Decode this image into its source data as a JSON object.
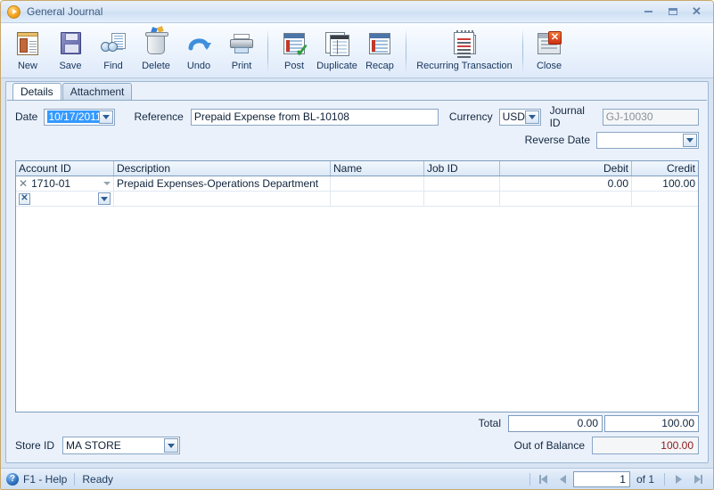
{
  "window": {
    "title": "General Journal",
    "app_icon": "orange-play-icon",
    "controls": {
      "minimize": "minimize-icon",
      "maximize": "maximize-icon",
      "close": "close-icon"
    }
  },
  "toolbar": {
    "buttons": [
      {
        "label": "New",
        "icon": "new-document-icon"
      },
      {
        "label": "Save",
        "icon": "floppy-disk-icon"
      },
      {
        "label": "Find",
        "icon": "binoculars-icon"
      },
      {
        "label": "Delete",
        "icon": "trash-can-icon"
      },
      {
        "label": "Undo",
        "icon": "undo-arrow-icon"
      },
      {
        "label": "Print",
        "icon": "printer-icon"
      },
      {
        "label": "Post",
        "icon": "post-checkmark-icon"
      },
      {
        "label": "Duplicate",
        "icon": "duplicate-pages-icon"
      },
      {
        "label": "Recap",
        "icon": "recap-report-icon"
      },
      {
        "label": "Recurring Transaction",
        "icon": "recurring-calendar-icon"
      },
      {
        "label": "Close",
        "icon": "close-window-icon"
      }
    ]
  },
  "tabs": [
    {
      "label": "Details",
      "active": true
    },
    {
      "label": "Attachment",
      "active": false
    }
  ],
  "form": {
    "date_label": "Date",
    "date_value": "10/17/2011",
    "reference_label": "Reference",
    "reference_value": "Prepaid Expense from BL-10108",
    "currency_label": "Currency",
    "currency_value": "USD",
    "journal_id_label": "Journal ID",
    "journal_id_value": "GJ-10030",
    "reverse_date_label": "Reverse Date",
    "reverse_date_value": ""
  },
  "grid": {
    "columns": [
      "Account ID",
      "Description",
      "Name",
      "Job ID",
      "Debit",
      "Credit"
    ],
    "rows": [
      {
        "account_id": "1710-01",
        "description": "Prepaid Expenses-Operations Department",
        "name": "",
        "job_id": "",
        "debit": "0.00",
        "credit": "100.00"
      },
      {
        "account_id": "",
        "description": "",
        "name": "",
        "job_id": "",
        "debit": "",
        "credit": ""
      }
    ],
    "total_label": "Total",
    "total_debit": "0.00",
    "total_credit": "100.00"
  },
  "footer": {
    "store_id_label": "Store ID",
    "store_id_value": "MA STORE",
    "out_of_balance_label": "Out of Balance",
    "out_of_balance_value": "100.00"
  },
  "statusbar": {
    "help_icon": "help-question-icon",
    "help_text": "F1 - Help",
    "status_text": "Ready",
    "nav": {
      "first": "first-page-icon",
      "previous": "previous-page-icon",
      "page_value": "1",
      "of_text": "of 1",
      "next": "next-page-icon",
      "last": "last-page-icon"
    }
  },
  "colors": {
    "accent": "#3399ff",
    "warning_text": "#8b1a1a",
    "window_border": "#c9a96a"
  }
}
